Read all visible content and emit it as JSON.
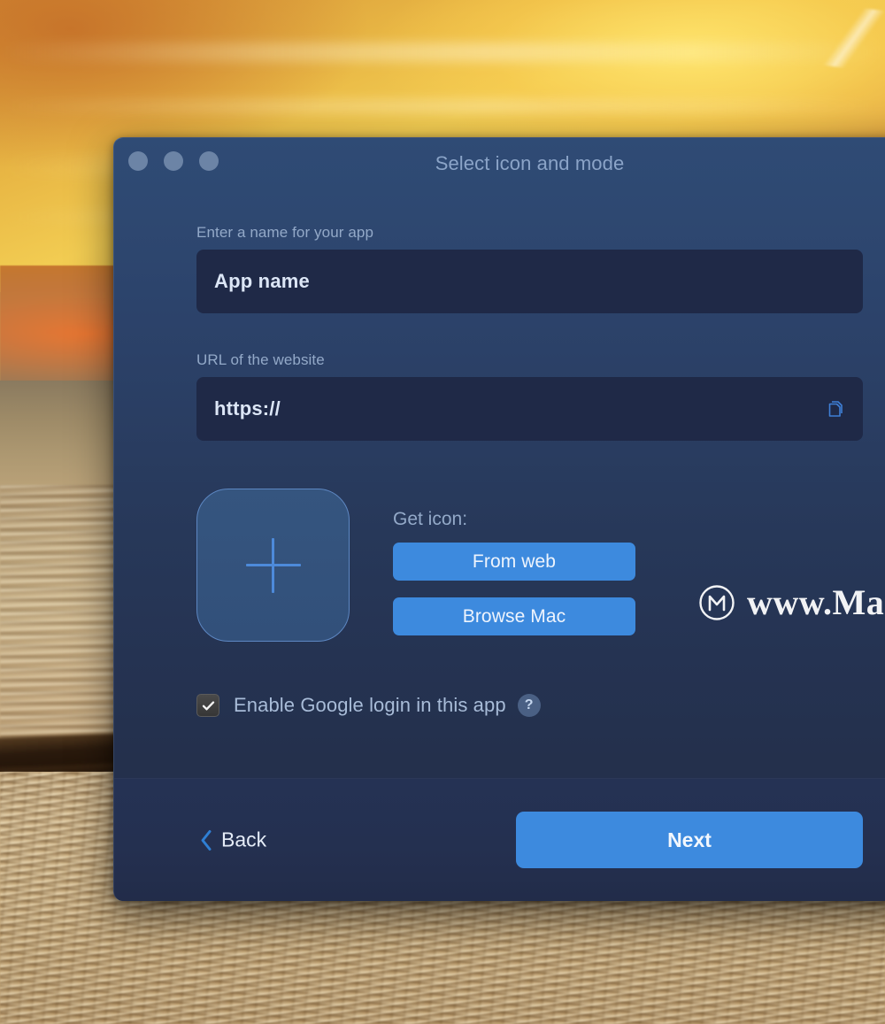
{
  "window": {
    "title": "Select icon and mode",
    "traffic_lights": [
      "close-button",
      "minimize-button",
      "zoom-button"
    ]
  },
  "form": {
    "name_label": "Enter a name for your app",
    "name_value": "App name",
    "url_label": "URL of the website",
    "url_value": "https://",
    "paste_icon": "copy-documents-icon"
  },
  "icon_section": {
    "dropzone_icon": "plus-icon",
    "get_icon_label": "Get icon:",
    "from_web_label": "From web",
    "browse_mac_label": "Browse Mac"
  },
  "options": {
    "google_login_label": "Enable Google login in this app",
    "google_login_checked": true,
    "help_glyph": "?"
  },
  "footer": {
    "back_label": "Back",
    "back_icon": "chevron-left-icon",
    "next_label": "Next"
  },
  "watermark": {
    "logo": "circled-m-logo",
    "text": "www.Ma"
  },
  "colors": {
    "accent_blue": "#3d8ade",
    "dialog_top": "#2f4b75",
    "dialog_bottom": "#232e4a",
    "field_bg": "#1f2947",
    "label_text": "#93a9c8",
    "title_text": "#8ba4c8"
  }
}
